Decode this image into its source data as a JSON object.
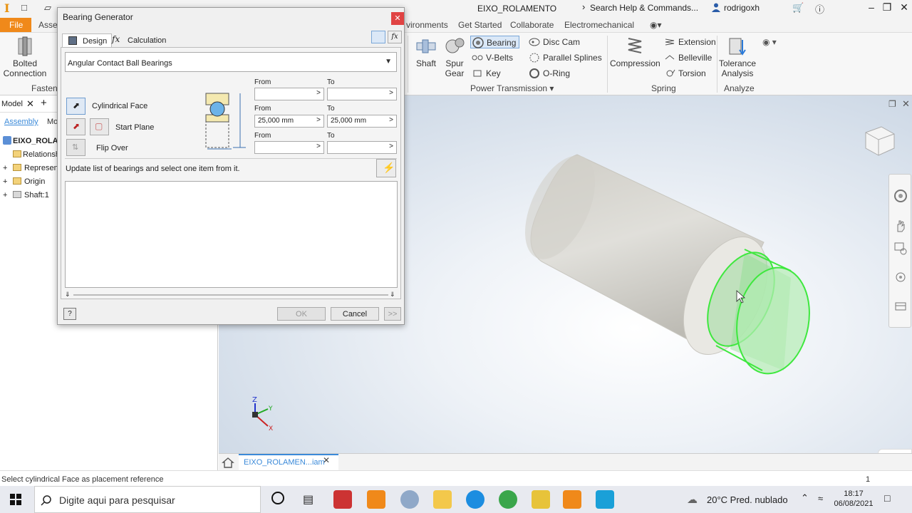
{
  "window": {
    "doc_title": "EIXO_ROLAMENTO",
    "search_placeholder": "Search Help & Commands...",
    "user": "rodrigoxh"
  },
  "ribbon_tabs": {
    "file": "File",
    "assemble": "Asse",
    "environments": "vironments",
    "get_started": "Get Started",
    "collaborate": "Collaborate",
    "electromechanical": "Electromechanical"
  },
  "ribbon": {
    "bolted_connection": "Bolted Connection",
    "fasten_group": "Fasten",
    "shaft": "Shaft",
    "spur_gear": "Spur Gear",
    "bearing": "Bearing",
    "v_belts": "V-Belts",
    "key": "Key",
    "disc_cam": "Disc Cam",
    "parallel_splines": "Parallel Splines",
    "o_ring": "O-Ring",
    "power_transmission_group": "Power Transmission",
    "compression": "Compression",
    "extension": "Extension",
    "belleville": "Belleville",
    "torsion": "Torsion",
    "spring_group": "Spring",
    "tolerance_analysis": "Tolerance Analysis",
    "analyze_group": "Analyze"
  },
  "browser": {
    "tab_model": "Model",
    "tab_assembly": "Assembly",
    "tab_modeling": "Mo",
    "root": "EIXO_ROLA",
    "items": [
      "Relationsh",
      "Represent",
      "Origin",
      "Shaft:1"
    ]
  },
  "dialog": {
    "title": "Bearing Generator",
    "tab_design": "Design",
    "tab_calculation": "Calculation",
    "bearing_type": "Angular Contact Ball Bearings",
    "cylindrical_face": "Cylindrical Face",
    "start_plane": "Start Plane",
    "flip_over": "Flip Over",
    "from_label": "From",
    "to_label": "To",
    "row1_from": "",
    "row1_to": "",
    "row2_from": "25,000 mm",
    "row2_to": "25,000 mm",
    "row3_from": "",
    "row3_to": "",
    "hint": "Update list of bearings and select one item from it.",
    "ok": "OK",
    "cancel": "Cancel",
    "more": ">>"
  },
  "doc_tab": "EIXO_ROLAMEN...iam",
  "status": {
    "message": "Select cylindrical Face as placement reference",
    "count": "1"
  },
  "taskbar": {
    "search": "Digite aqui para pesquisar",
    "weather": "20°C  Pred. nublado",
    "time": "18:17",
    "date": "06/08/2021"
  },
  "colors": {
    "accent": "#f0891a",
    "selection_green": "#3ee83e",
    "link_blue": "#3b8ad9"
  }
}
